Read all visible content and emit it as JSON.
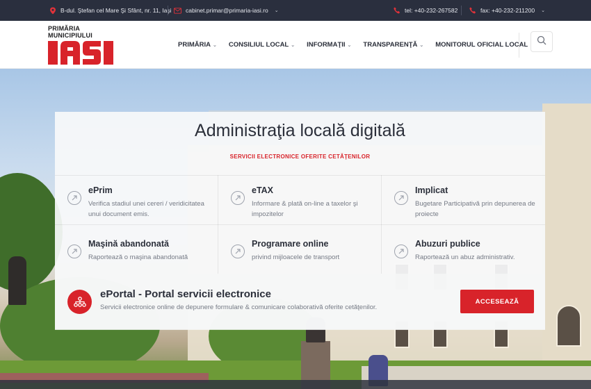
{
  "topbar": {
    "address": "B-dul. Ştefan cel Mare Şi Sfânt, nr. 11, Iaşi",
    "email": "cabinet.primar@primaria-iasi.ro",
    "phone": "tel: +40-232-267582",
    "fax": "fax: +40-232-211200"
  },
  "logo": {
    "line1": "PRIMĂRIA",
    "line2": "MUNICIPIULUI",
    "name": "IAŞI"
  },
  "nav": [
    {
      "label": "PRIMĂRIA"
    },
    {
      "label": "CONSILIUL LOCAL"
    },
    {
      "label": "INFORMAŢII"
    },
    {
      "label": "TRANSPARENŢĂ"
    },
    {
      "label": "MONITORUL OFICIAL LOCAL"
    }
  ],
  "hero": {
    "title": "Administraţia locală digitală",
    "subtitle": "SERVICII ELECTRONICE OFERITE CETĂŢENILOR"
  },
  "services": [
    {
      "name": "ePrim",
      "desc": "Verifica stadiul unei cereri / veridicitatea unui document emis."
    },
    {
      "name": "eTAX",
      "desc": "Informare & plată on-line a taxelor şi impozitelor"
    },
    {
      "name": "Implicat",
      "desc": "Bugetare Participativă prin depunerea de proiecte"
    },
    {
      "name": "Maşină abandonată",
      "desc": "Raportează o maşina abandonată"
    },
    {
      "name": "Programare online",
      "desc": "privind mijloacele de transport"
    },
    {
      "name": "Abuzuri publice",
      "desc": "Raportează un abuz administrativ."
    }
  ],
  "eportal": {
    "title": "ePortal - Portal servicii electronice",
    "desc": "Servicii electronice online de depunere formulare & comunicare colaborativă oferite cetăţenilor.",
    "button": "ACCESEAZĂ"
  },
  "colors": {
    "brand_red": "#d8232a",
    "topbar_bg": "#2a2f3e",
    "text_dark": "#2b2f3a"
  },
  "icons": [
    "map-pin-icon",
    "mail-icon",
    "phone-icon",
    "fax-icon",
    "chevron-down-icon",
    "search-icon",
    "service-arrow-icon",
    "eportal-network-icon"
  ]
}
